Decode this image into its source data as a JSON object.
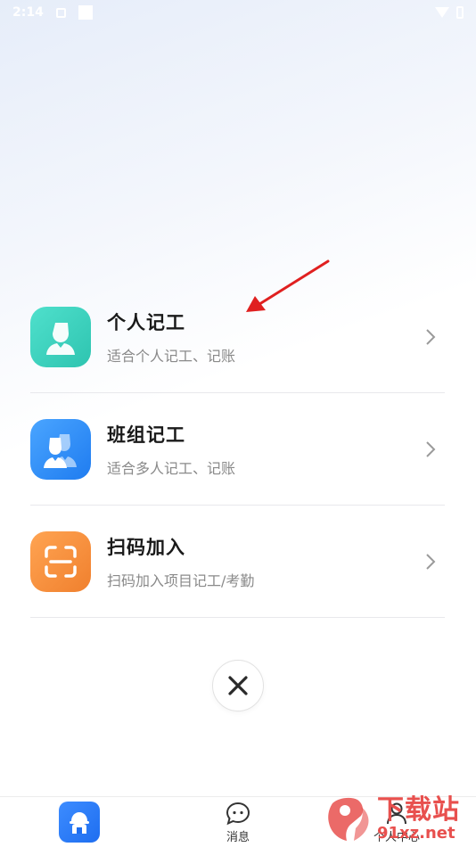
{
  "status_bar": {
    "time": "2:14"
  },
  "menu": {
    "items": [
      {
        "title": "个人记工",
        "subtitle": "适合个人记工、记账"
      },
      {
        "title": "班组记工",
        "subtitle": "适合多人记工、记账"
      },
      {
        "title": "扫码加入",
        "subtitle": "扫码加入项目记工/考勤"
      }
    ]
  },
  "tabs": [
    {
      "label": ""
    },
    {
      "label": "消息"
    },
    {
      "label": "个人中心"
    }
  ],
  "watermark": {
    "cn": "下载站",
    "en": "91xz.net"
  },
  "colors": {
    "green_icon": "#2ec4b0",
    "blue_icon": "#1f7cf0",
    "orange_icon": "#f0802e",
    "annotation_arrow": "#e02020",
    "watermark": "#e8504e"
  },
  "icons": {
    "item_0": "person-silhouette-icon",
    "item_1": "group-silhouette-icon",
    "item_2": "scan-frame-icon",
    "close": "close-icon",
    "tab_home": "worker-helmet-icon",
    "tab_message": "chat-bubble-icon",
    "tab_profile": "person-icon"
  }
}
